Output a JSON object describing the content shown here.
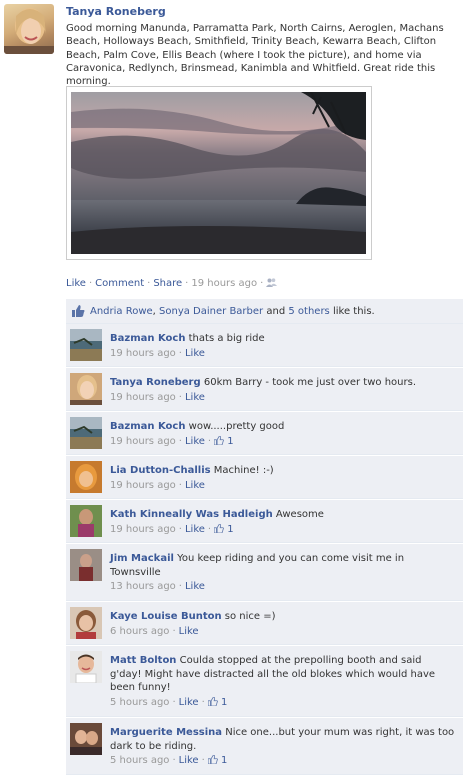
{
  "post": {
    "author": "Tanya Roneberg",
    "text": "Good morning Manunda, Parramatta Park, North Cairns, Aeroglen, Machans Beach, Holloways Beach, Smithfield, Trinity Beach, Kewarra Beach, Clifton Beach, Palm Cove, Ellis Beach (where I took the picture), and home via Caravonica, Redlynch, Brinsmead, Kanimbla and Whitfield. Great ride this morning.",
    "actions": {
      "like": "Like",
      "comment": "Comment",
      "share": "Share",
      "time": "19 hours ago"
    }
  },
  "likes": {
    "name1": "Andria Rowe",
    "name2": "Sonya Dainer Barber",
    "joiner": "and",
    "others": "5 others",
    "suffix": "like this."
  },
  "comments": [
    {
      "name": "Bazman Koch",
      "text": "thats a big ride",
      "time": "19 hours ago",
      "like": "Like",
      "count": ""
    },
    {
      "name": "Tanya Roneberg",
      "text": "60km Barry - took me just over two hours.",
      "time": "19 hours ago",
      "like": "Like",
      "count": ""
    },
    {
      "name": "Bazman Koch",
      "text": "wow.....pretty good",
      "time": "19 hours ago",
      "like": "Like",
      "count": "1"
    },
    {
      "name": "Lia Dutton-Challis",
      "text": "Machine! :-)",
      "time": "19 hours ago",
      "like": "Like",
      "count": ""
    },
    {
      "name": "Kath Kinneally Was Hadleigh",
      "text": "Awesome",
      "time": "19 hours ago",
      "like": "Like",
      "count": "1"
    },
    {
      "name": "Jim Mackail",
      "text": "You keep riding and you can come visit me in Townsville",
      "time": "13 hours ago",
      "like": "Like",
      "count": ""
    },
    {
      "name": "Kaye Louise Bunton",
      "text": "so nice =)",
      "time": "6 hours ago",
      "like": "Like",
      "count": ""
    },
    {
      "name": "Matt Bolton",
      "text": "Coulda stopped at the prepolling booth and said g'day! Might have distracted all the old blokes which would have been funny!",
      "time": "5 hours ago",
      "like": "Like",
      "count": "1"
    },
    {
      "name": "Marguerite Messina",
      "text": "Nice one...but your mum was right, it was too dark to be riding.",
      "time": "5 hours ago",
      "like": "Like",
      "count": "1"
    }
  ],
  "colors": {
    "link": "#3b5998",
    "comment_bg": "#edeff4",
    "meta": "#999999"
  }
}
